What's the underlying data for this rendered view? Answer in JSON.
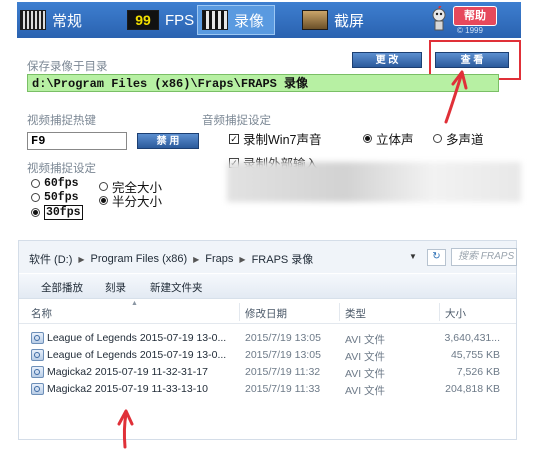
{
  "fraps": {
    "tabs": {
      "general": "常规",
      "fps_icon": "99",
      "fps": "FPS",
      "movies": "录像",
      "screenshots": "截屏"
    },
    "help_label": "帮助",
    "version": "© 1999",
    "folder_label": "保存录像于目录",
    "folder_path": "d:\\Program Files (x86)\\Fraps\\FRAPS 录像",
    "change_button": "更 改",
    "view_button": "查 看",
    "hotkey_label": "视频捕捉热键",
    "hotkey_value": "F9",
    "disable_button": "禁 用",
    "audio_label": "音频捕捉设定",
    "record_win7_sound": "录制Win7声音",
    "record_external_input": "录制外部输入",
    "stereo": "立体声",
    "multichannel": "多声道",
    "video_label": "视频捕捉设定",
    "fps_60": "60fps",
    "fps_50": "50fps",
    "fps_30": "30fps",
    "full_size": "完全大小",
    "half_size": "半分大小",
    "selected_fps": "30fps",
    "selected_size": "半分大小"
  },
  "explorer": {
    "breadcrumb": [
      "软件 (D:)",
      "Program Files (x86)",
      "Fraps",
      "FRAPS 录像"
    ],
    "search_placeholder": "搜索 FRAPS 录...",
    "toolbar": {
      "play_all": "全部播放",
      "burn": "刻录",
      "new_folder": "新建文件夹"
    },
    "columns": {
      "name": "名称",
      "date": "修改日期",
      "type": "类型",
      "size": "大小"
    },
    "files": [
      {
        "name": "League of Legends 2015-07-19 13-0...",
        "date": "2015/7/19 13:05",
        "type": "AVI 文件",
        "size": "3,640,431..."
      },
      {
        "name": "League of Legends 2015-07-19 13-0...",
        "date": "2015/7/19 13:05",
        "type": "AVI 文件",
        "size": "45,755 KB"
      },
      {
        "name": "Magicka2 2015-07-19 11-32-31-17",
        "date": "2015/7/19 11:32",
        "type": "AVI 文件",
        "size": "7,526 KB"
      },
      {
        "name": "Magicka2 2015-07-19 11-33-13-10",
        "date": "2015/7/19 11:33",
        "type": "AVI 文件",
        "size": "204,818 KB"
      }
    ]
  },
  "colors": {
    "tabbar_blue": "#2a62b0",
    "path_green": "#b7f0a3",
    "highlight_red": "#e03038"
  }
}
